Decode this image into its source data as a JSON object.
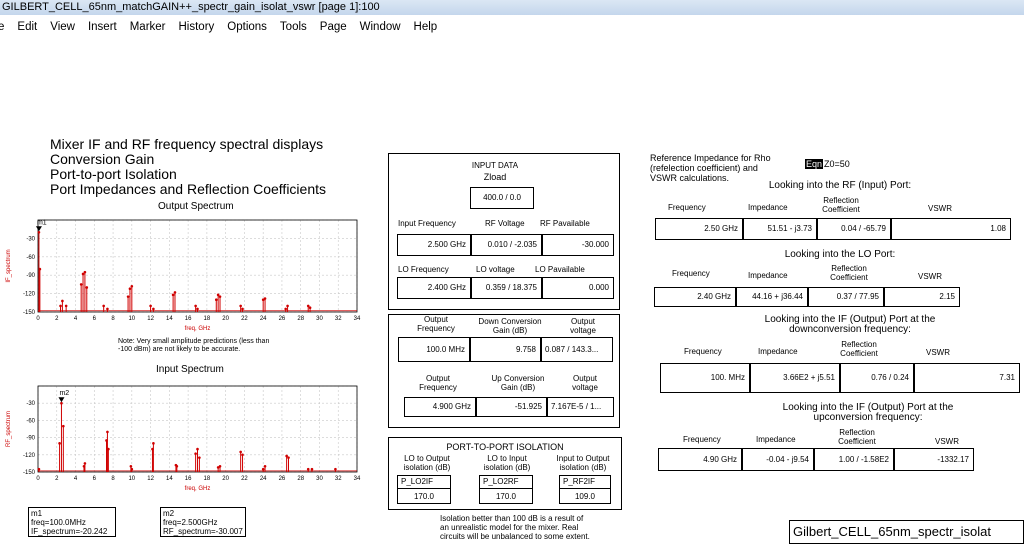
{
  "window": {
    "title": "GILBERT_CELL_65nm_matchGAIN++_spectr_gain_isolat_vswr [page 1]:100"
  },
  "menu": {
    "items": [
      "e",
      "Edit",
      "View",
      "Insert",
      "Marker",
      "History",
      "Options",
      "Tools",
      "Page",
      "Window",
      "Help"
    ]
  },
  "heading": {
    "lines": [
      "Mixer IF and RF frequency spectral displays",
      "Conversion Gain",
      "Port-to-port  Isolation",
      "Port Impedances and Reflection Coefficients"
    ]
  },
  "output_spectrum": {
    "title": "Output Spectrum",
    "ylabel": "IF_spectrum",
    "xlabel": "freq, GHz",
    "marker": "m1",
    "note": [
      "Note:  Very small amplitude predictions (less than",
      "-100 dBm) are not likely to be accurate."
    ]
  },
  "input_spectrum": {
    "title": "Input Spectrum",
    "ylabel": "RF_spectrum",
    "xlabel": "freq, GHz",
    "marker": "m2"
  },
  "chart_data": [
    {
      "type": "line",
      "title": "Output Spectrum",
      "xlabel": "freq, GHz",
      "ylabel": "IF_spectrum",
      "xlim": [
        0,
        34
      ],
      "ylim": [
        -150,
        0
      ],
      "xticks": [
        0,
        2,
        4,
        6,
        8,
        10,
        12,
        14,
        16,
        18,
        20,
        22,
        24,
        26,
        28,
        30,
        32,
        34
      ],
      "yticks": [
        -30,
        -60,
        -90,
        -120,
        -150
      ],
      "series": [
        {
          "x": [
            0.1,
            0.2,
            2.4,
            2.6,
            3.0,
            4.6,
            4.8,
            5.0,
            5.2,
            7.0,
            7.4,
            9.6,
            9.8,
            10.0,
            12.0,
            12.3,
            14.4,
            14.6,
            16.8,
            17.0,
            19.0,
            19.2,
            19.4,
            21.6,
            21.8,
            24.0,
            24.2,
            26.4,
            26.6,
            28.8,
            29.0
          ],
          "y": [
            -20,
            -80,
            -140,
            -132,
            -140,
            -105,
            -88,
            -85,
            -110,
            -140,
            -145,
            -125,
            -112,
            -108,
            -140,
            -145,
            -122,
            -118,
            -140,
            -145,
            -130,
            -122,
            -125,
            -140,
            -145,
            -130,
            -128,
            -145,
            -140,
            -140,
            -143
          ]
        }
      ]
    },
    {
      "type": "line",
      "title": "Input Spectrum",
      "xlabel": "freq, GHz",
      "ylabel": "RF_spectrum",
      "xlim": [
        0,
        34
      ],
      "ylim": [
        -150,
        0
      ],
      "xticks": [
        0,
        2,
        4,
        6,
        8,
        10,
        12,
        14,
        16,
        18,
        20,
        22,
        24,
        26,
        28,
        30,
        32,
        34
      ],
      "yticks": [
        -30,
        -60,
        -90,
        -120,
        -150
      ],
      "series": [
        {
          "x": [
            0.1,
            2.3,
            2.5,
            2.7,
            4.9,
            5.0,
            7.3,
            7.4,
            7.5,
            9.9,
            10.0,
            12.2,
            12.3,
            14.7,
            14.8,
            16.8,
            17.0,
            17.2,
            19.2,
            19.4,
            21.6,
            21.8,
            24.0,
            24.2,
            26.5,
            26.7,
            28.8,
            29.2,
            31.7
          ],
          "y": [
            -145,
            -100,
            -30,
            -70,
            -140,
            -135,
            -95,
            -80,
            -110,
            -140,
            -145,
            -110,
            -100,
            -138,
            -140,
            -118,
            -110,
            -125,
            -142,
            -140,
            -115,
            -120,
            -145,
            -140,
            -122,
            -125,
            -145,
            -145,
            -145
          ]
        }
      ]
    }
  ],
  "markers": {
    "m1": {
      "name": "m1",
      "freq": "freq=100.0MHz",
      "val": "IF_spectrum=-20.242"
    },
    "m2": {
      "name": "m2",
      "freq": "freq=2.500GHz",
      "val": "RF_spectrum=-30.007"
    }
  },
  "input_data": {
    "title": "INPUT DATA",
    "zload_label": "Zload",
    "zload": "400.0 / 0.0",
    "rf_headers": [
      "Input Frequency",
      "RF Voltage",
      "RF Pavailable"
    ],
    "rf_values": [
      "2.500 GHz",
      "0.010 / -2.035",
      "-30.000"
    ],
    "lo_headers": [
      "LO Frequency",
      "LO voltage",
      "LO Pavailable"
    ],
    "lo_values": [
      "2.400 GHz",
      "0.359 / 18.375",
      "0.000"
    ]
  },
  "gain": {
    "down_headers": [
      "Output\nFrequency",
      "Down Conversion\nGain (dB)",
      "Output\nvoltage"
    ],
    "down_values": [
      "100.0 MHz",
      "9.758",
      "0.087 / 143.3..."
    ],
    "up_headers": [
      "Output\nFrequency",
      "Up Conversion\nGain (dB)",
      "Output\nvoltage"
    ],
    "up_values": [
      "4.900 GHz",
      "-51.925",
      "7.167E-5 / 1..."
    ]
  },
  "isolation": {
    "title": "PORT-TO-PORT ISOLATION",
    "headers": [
      "LO to Output\nisolation (dB)",
      "LO to Input\nisolation (dB)",
      "Input to Output\nisolation (dB)"
    ],
    "names": [
      "P_LO2IF",
      "P_LO2RF",
      "P_RF2IF"
    ],
    "values": [
      "170.0",
      "170.0",
      "109.0"
    ],
    "note": [
      "Isolation better than 100 dB is a result of",
      "an unrealistic model for the mixer.  Real",
      "circuits will be unbalanced to some extent."
    ]
  },
  "reference": {
    "text": [
      "Reference Impedance for Rho",
      "(refelection coefficient) and",
      "VSWR calculations."
    ],
    "eqn": "Eqn",
    "z0": "Z0=50"
  },
  "rf_port": {
    "title": "Looking into the RF (Input) Port:",
    "headers": [
      "Frequency",
      "Impedance",
      "Reflection\nCoefficient",
      "VSWR"
    ],
    "values": [
      "2.50 GHz",
      "51.51 - j3.73",
      "0.04 / -65.79",
      "1.08"
    ]
  },
  "lo_port": {
    "title": "Looking into the LO Port:",
    "headers": [
      "Frequency",
      "Impedance",
      "Reflection\nCoefficient",
      "VSWR"
    ],
    "values": [
      "2.40 GHz",
      "44.16 + j36.44",
      "0.37 / 77.95",
      "2.15"
    ]
  },
  "if_down": {
    "title": [
      "Looking into the IF (Output) Port at the",
      "downconversion frequency:"
    ],
    "headers": [
      "Frequency",
      "Impedance",
      "Reflection\nCoefficient",
      "VSWR"
    ],
    "values": [
      "100. MHz",
      "3.66E2 + j5.51",
      "0.76 / 0.24",
      "7.31"
    ]
  },
  "if_up": {
    "title": [
      "Looking into the IF (Output) Port at the",
      "upconversion frequency:"
    ],
    "headers": [
      "Frequency",
      "Impedance",
      "Reflection\nCoefficient",
      "VSWR"
    ],
    "values": [
      "4.90 GHz",
      "-0.04 - j9.54",
      "1.00 / -1.58E2",
      "-1332.17"
    ]
  },
  "footer": {
    "name": "Gilbert_CELL_65nm_spectr_isolat"
  }
}
